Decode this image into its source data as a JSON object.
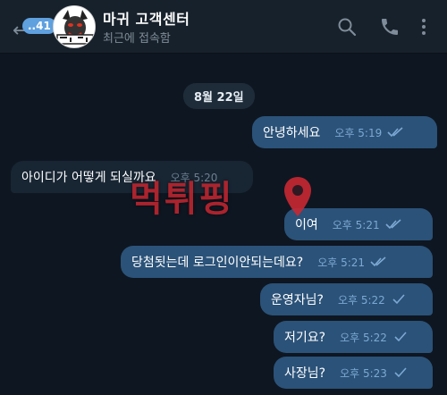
{
  "header": {
    "back_label": "←",
    "unread_count": "..41",
    "title": "마귀 고객센터",
    "status": "최근에 접속함",
    "icons": [
      "back-arrow-icon",
      "search-icon",
      "phone-icon",
      "more-vertical-icon"
    ]
  },
  "chat": {
    "date_label": "8월 22일",
    "messages": [
      {
        "direction": "out",
        "text": "안녕하세요",
        "time": "오후 5:19",
        "status": "read"
      },
      {
        "direction": "in",
        "text": "아이디가 어떻게 되실까요",
        "time": "오후 5:20"
      },
      {
        "direction": "out",
        "text": "이여",
        "time": "오후 5:21",
        "status": "read"
      },
      {
        "direction": "out",
        "text": "당첨됫는데 로그인이안되는데요?",
        "time": "오후 5:21",
        "status": "read"
      },
      {
        "direction": "out",
        "text": "운영자님?",
        "time": "오후 5:22",
        "status": "sent"
      },
      {
        "direction": "out",
        "text": "저기요?",
        "time": "오후 5:22",
        "status": "sent"
      },
      {
        "direction": "out",
        "text": "사장님?",
        "time": "오후 5:23",
        "status": "sent"
      }
    ]
  },
  "watermark": {
    "text": "먹튀핑"
  },
  "colors": {
    "background": "#0e1621",
    "header": "#17212b",
    "outgoing_bubble": "#2b5278",
    "incoming_bubble": "#182533",
    "accent": "#5fa0de",
    "watermark": "#c82832"
  }
}
